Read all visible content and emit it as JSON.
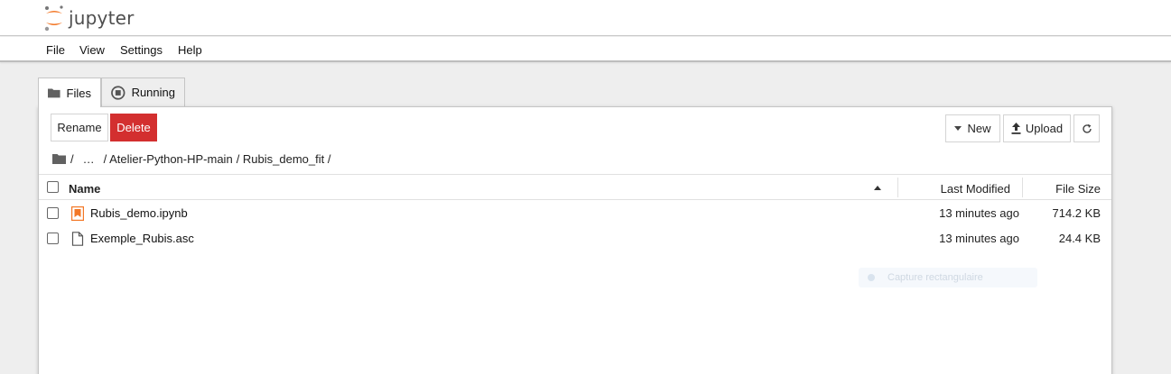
{
  "app": {
    "logo_text": "jupyter"
  },
  "menu": {
    "file": "File",
    "view": "View",
    "settings": "Settings",
    "help": "Help"
  },
  "tabs": {
    "files": "Files",
    "running": "Running"
  },
  "toolbar": {
    "rename": "Rename",
    "delete": "Delete",
    "new": "New",
    "upload": "Upload"
  },
  "breadcrumb": {
    "root": "/",
    "ellipsis": "…",
    "path1": "/ Atelier-Python-HP-main",
    "path2": "/ Rubis_demo_fit /"
  },
  "columns": {
    "name": "Name",
    "modified": "Last Modified",
    "size": "File Size"
  },
  "files": [
    {
      "name": "Rubis_demo.ipynb",
      "modified": "13 minutes ago",
      "size": "714.2 KB",
      "icon": "notebook-icon"
    },
    {
      "name": "Exemple_Rubis.asc",
      "modified": "13 minutes ago",
      "size": "24.4 KB",
      "icon": "file-icon"
    }
  ],
  "overlay": {
    "text": "Capture rectangulaire"
  },
  "colors": {
    "delete": "#d32f2f",
    "jupyter_orange": "#f37726",
    "background": "#eeeeee"
  }
}
